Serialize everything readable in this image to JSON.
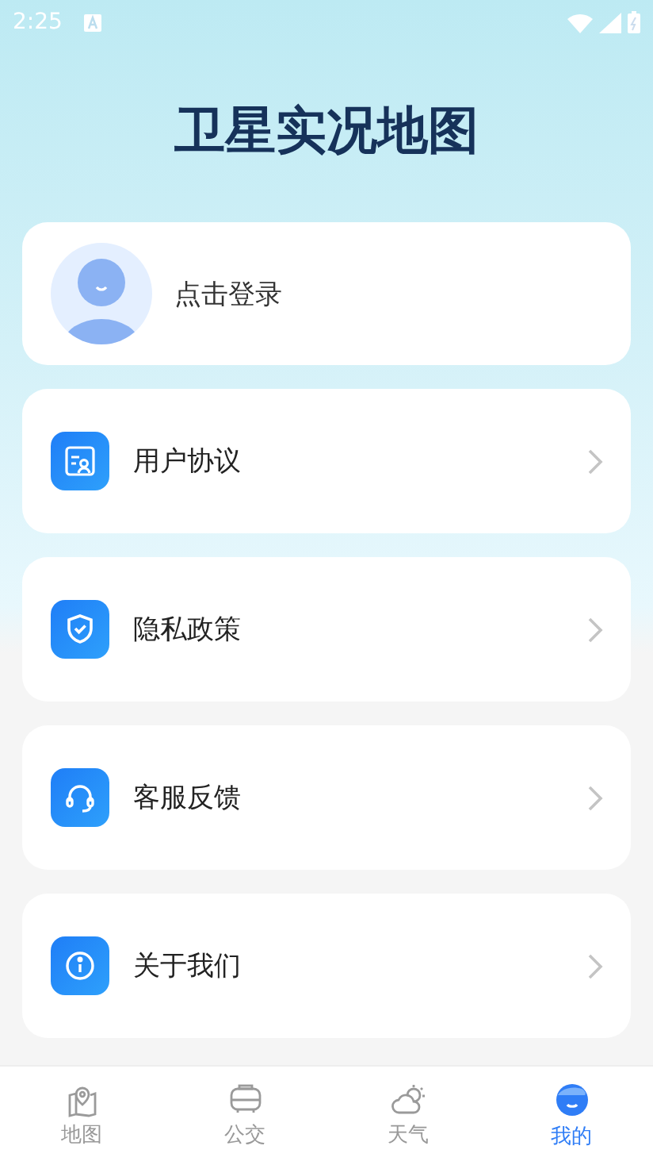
{
  "status_bar": {
    "time": "2:25"
  },
  "title": "卫星实况地图",
  "login": {
    "label": "点击登录"
  },
  "menu": [
    {
      "kind": "agreement",
      "label": "用户协议"
    },
    {
      "kind": "privacy",
      "label": "隐私政策"
    },
    {
      "kind": "service",
      "label": "客服反馈"
    },
    {
      "kind": "about",
      "label": "关于我们"
    }
  ],
  "tabs": [
    {
      "kind": "map",
      "label": "地图",
      "selected": false
    },
    {
      "kind": "bus",
      "label": "公交",
      "selected": false
    },
    {
      "kind": "weather",
      "label": "天气",
      "selected": false
    },
    {
      "kind": "profile",
      "label": "我的",
      "selected": true
    }
  ]
}
